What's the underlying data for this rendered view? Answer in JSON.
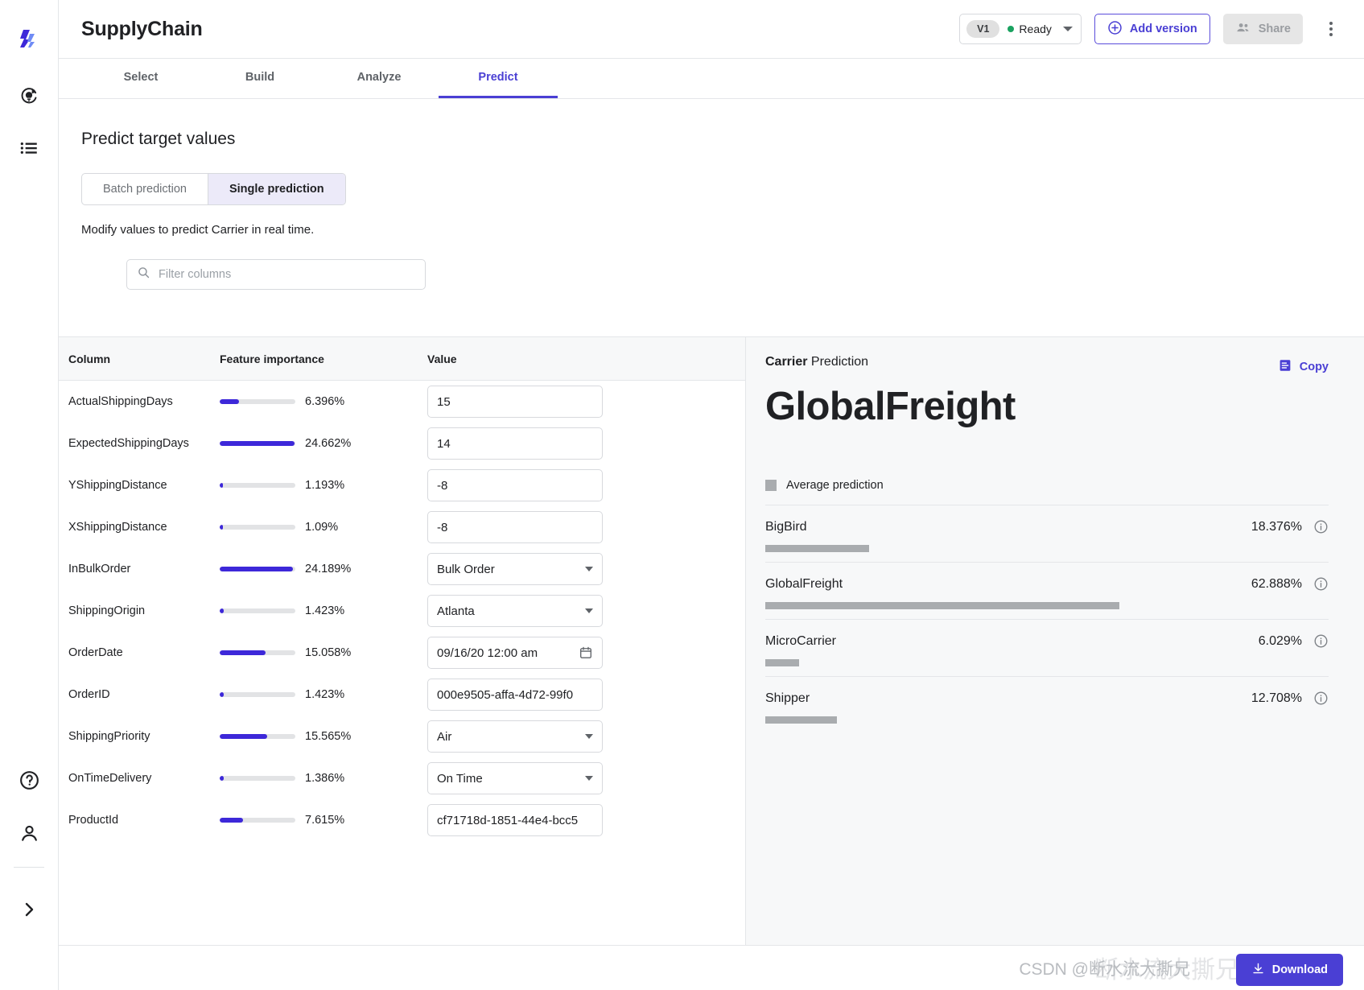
{
  "app": {
    "title": "SupplyChain"
  },
  "topbar": {
    "version_chip": "V1",
    "status_label": "Ready",
    "add_version_label": "Add version",
    "share_label": "Share"
  },
  "tabs": [
    {
      "label": "Select",
      "active": false
    },
    {
      "label": "Build",
      "active": false
    },
    {
      "label": "Analyze",
      "active": false
    },
    {
      "label": "Predict",
      "active": true
    }
  ],
  "page": {
    "section_title": "Predict target values",
    "segmented": [
      {
        "label": "Batch prediction",
        "selected": false
      },
      {
        "label": "Single prediction",
        "selected": true
      }
    ],
    "sub_note": "Modify values to predict Carrier in real time.",
    "search_placeholder": "Filter columns",
    "search_value": ""
  },
  "table": {
    "headers": [
      "Column",
      "Feature importance",
      "Value"
    ],
    "rows": [
      {
        "column": "ActualShippingDays",
        "importance": "6.396%",
        "importance_value": 6.396,
        "value": "15",
        "type": "text"
      },
      {
        "column": "ExpectedShippingDays",
        "importance": "24.662%",
        "importance_value": 24.662,
        "value": "14",
        "type": "text"
      },
      {
        "column": "YShippingDistance",
        "importance": "1.193%",
        "importance_value": 1.193,
        "value": "-8",
        "type": "text"
      },
      {
        "column": "XShippingDistance",
        "importance": "1.09%",
        "importance_value": 1.09,
        "value": "-8",
        "type": "text"
      },
      {
        "column": "InBulkOrder",
        "importance": "24.189%",
        "importance_value": 24.189,
        "value": "Bulk Order",
        "type": "select"
      },
      {
        "column": "ShippingOrigin",
        "importance": "1.423%",
        "importance_value": 1.423,
        "value": "Atlanta",
        "type": "select"
      },
      {
        "column": "OrderDate",
        "importance": "15.058%",
        "importance_value": 15.058,
        "value": "09/16/20 12:00 am",
        "type": "date"
      },
      {
        "column": "OrderID",
        "importance": "1.423%",
        "importance_value": 1.423,
        "value": "000e9505-affa-4d72-99f0",
        "type": "text"
      },
      {
        "column": "ShippingPriority",
        "importance": "15.565%",
        "importance_value": 15.565,
        "value": "Air",
        "type": "select"
      },
      {
        "column": "OnTimeDelivery",
        "importance": "1.386%",
        "importance_value": 1.386,
        "value": "On Time",
        "type": "select"
      },
      {
        "column": "ProductId",
        "importance": "7.615%",
        "importance_value": 7.615,
        "value": "cf71718d-1851-44e4-bcc5",
        "type": "text"
      }
    ]
  },
  "prediction": {
    "target_name": "Carrier",
    "title_suffix": " Prediction",
    "copy_label": "Copy",
    "result": "GlobalFreight",
    "legend_label": "Average prediction",
    "legend_color": "#a9acaf",
    "classes": [
      {
        "name": "BigBird",
        "pct_label": "18.376%",
        "pct": 18.376
      },
      {
        "name": "GlobalFreight",
        "pct_label": "62.888%",
        "pct": 62.888
      },
      {
        "name": "MicroCarrier",
        "pct_label": "6.029%",
        "pct": 6.029
      },
      {
        "name": "Shipper",
        "pct_label": "12.708%",
        "pct": 12.708
      }
    ]
  },
  "footer": {
    "download_label": "Download",
    "watermark": "CSDN @断水流大撕兄"
  },
  "colors": {
    "accent": "#4a3fd4",
    "bar": "#3d28d9",
    "ready": "#1aa260",
    "gray_bar": "#a9acaf"
  }
}
